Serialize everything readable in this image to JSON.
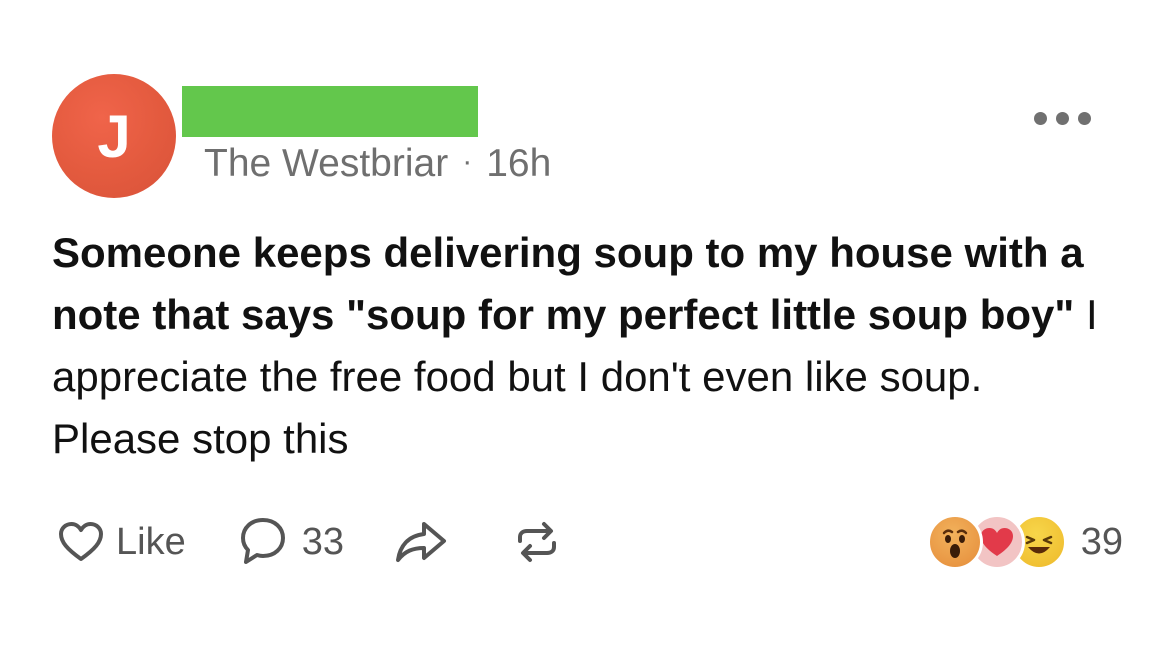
{
  "post": {
    "avatar_initial": "J",
    "group_name": "The Westbriar",
    "separator": "·",
    "time_ago": "16h",
    "body_bold": "Someone keeps delivering soup to my house with a note that says \"soup for my perfect little soup boy\"",
    "body_regular": " I appreciate the free food but I don't even like soup. Please stop this"
  },
  "actions": {
    "like_label": "Like",
    "comment_count": "33",
    "reaction_count": "39"
  },
  "icons": {
    "more": "more-options-icon",
    "like": "heart-outline-icon",
    "comment": "speech-bubble-icon",
    "share": "share-arrow-icon",
    "repost": "repost-icon",
    "reactions": [
      "wow-face-icon",
      "heart-icon",
      "laughing-face-icon"
    ]
  },
  "colors": {
    "avatar": "#e35a3e",
    "redaction": "#63c74c",
    "muted_text": "#6f6f6f"
  }
}
